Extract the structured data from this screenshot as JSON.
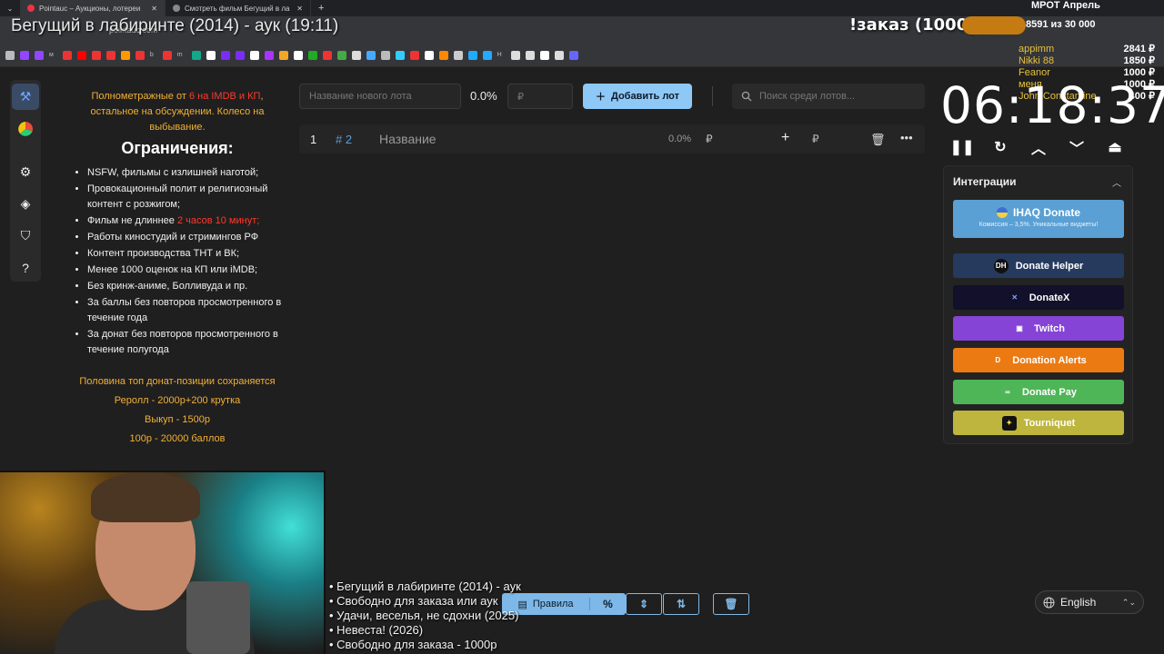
{
  "browser": {
    "tabs": [
      {
        "title": "Pointauc – Аукционы, лотереи"
      },
      {
        "title": "Смотреть фильм Бегущий в ла"
      }
    ],
    "url": "pointauc.com",
    "bookmark_labels": [
      "м",
      "b",
      "m",
      "H"
    ]
  },
  "overlay": {
    "title": "Бегущий в лабиринте (2014) - аук (19:11)",
    "order": "!заказ (1000р)",
    "mrot": "МРОТ Апрель",
    "count": "8591 из 30 000",
    "donors": [
      {
        "name": "appimm",
        "amount": "2841 ₽"
      },
      {
        "name": "Nikki 88",
        "amount": "1850 ₽"
      },
      {
        "name": "Feanor",
        "amount": "1000 ₽"
      },
      {
        "name": "меня",
        "amount": "1000 ₽"
      },
      {
        "name": "John Constantine",
        "amount": "400 ₽"
      }
    ]
  },
  "rules": {
    "intro_a": "Полнометражные от ",
    "intro_red": "6 на IMDB и КП",
    "intro_b": ", остальное на обсуждении. Колесо на выбывание.",
    "heading": "Ограничения:",
    "items": [
      "NSFW, фильмы с излишней наготой;",
      "Провокационный полит и религиозный контент с розжигом;",
      "Фильм не длиннее ",
      "Работы киностудий и стримингов РФ",
      "Контент производства ТНТ и ВК;",
      "Менее 1000 оценок на КП или iMDB;",
      "Без кринж-аниме, Болливуда и пр.",
      "За баллы без повторов просмотренного в течение года",
      "За донат без повторов просмотренного в течение полугода"
    ],
    "item3_red": "2 часов 10 минут;",
    "bottom": [
      "Половина топ донат-позиции сохраняется",
      "Реролл - 2000р+200 крутка",
      "Выкуп - 1500р",
      "100р - 20000 баллов"
    ]
  },
  "lot_form": {
    "name_placeholder": "Название нового лота",
    "percent": "0.0%",
    "price_placeholder": "₽",
    "add_label": "Добавить лот",
    "search_placeholder": "Поиск среди лотов..."
  },
  "lots": [
    {
      "index": "1",
      "hash": "# 2",
      "name": "Название",
      "percent": "0.0%",
      "currency": "₽"
    }
  ],
  "timer": {
    "value": "06:18:37"
  },
  "integrations": {
    "title": "Интеграции",
    "ihaq_title": "IHAQ Donate",
    "ihaq_sub": "Комиссия – 3,5%. Уникальные виджеты!",
    "buttons": [
      {
        "label": "Donate Helper",
        "color": "#263a5e",
        "icon": "DH"
      },
      {
        "label": "DonateX",
        "color": "#12102a",
        "icon": "✕"
      },
      {
        "label": "Twitch",
        "color": "#8544d6",
        "icon": "▣"
      },
      {
        "label": "Donation Alerts",
        "color": "#ec7a12",
        "icon": "D"
      },
      {
        "label": "Donate Pay",
        "color": "#4fb657",
        "icon": "∞"
      },
      {
        "label": "Tourniquet",
        "color": "#bdb53e",
        "icon": "✦"
      }
    ]
  },
  "ticker": [
    "• Бегущий в лабиринте (2014) - аук",
    "• Свободно для заказа или аук",
    "• Удачи, веселья, не сдохни (2025)",
    "• Невеста! (2026)",
    "• Свободно для заказа - 1000р"
  ],
  "toolbar": {
    "rules_label": "Правила",
    "percent_label": "%"
  },
  "language": {
    "selected": "English"
  }
}
